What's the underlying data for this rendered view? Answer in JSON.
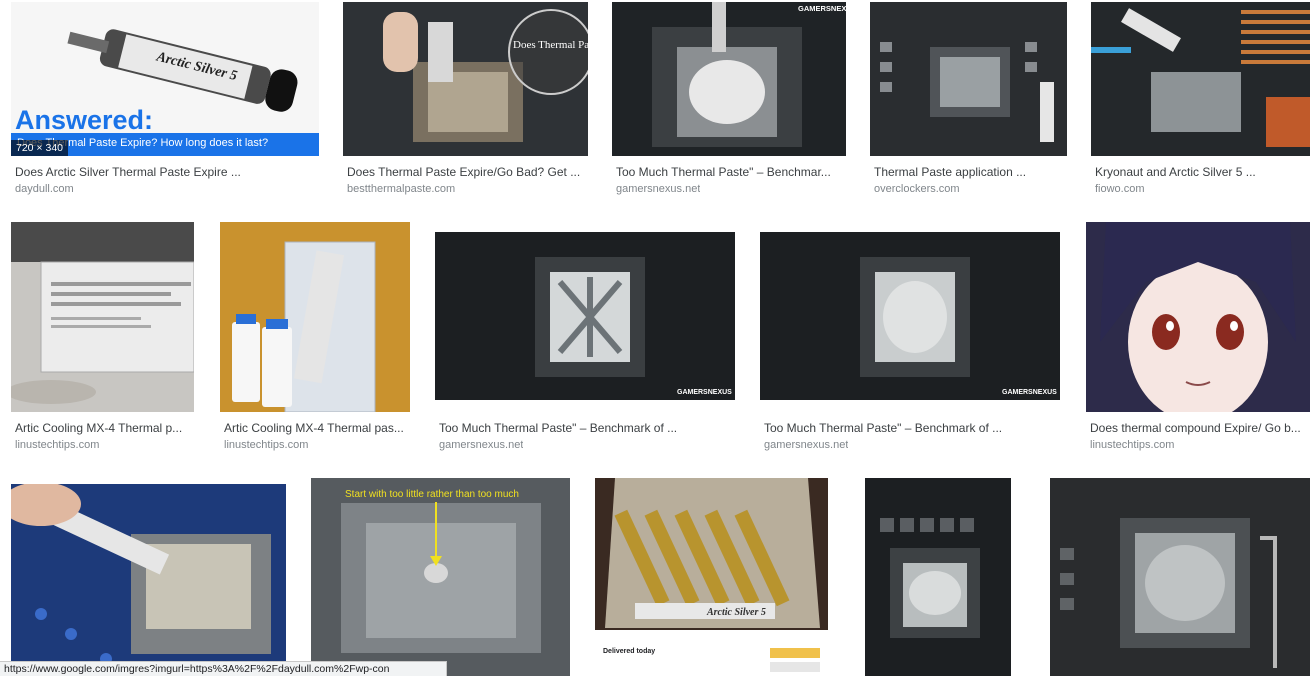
{
  "results": [
    {
      "caption": "Does Arctic Silver Thermal Paste Expire ...",
      "domain": "daydull.com",
      "dims": "720 × 340",
      "overlay_title": "Answered:",
      "overlay_sub": "Does Thermal Paste Expire? How long does it last?",
      "product_label": "Arctic Silver 5"
    },
    {
      "caption": "Does Thermal Paste Expire/Go Bad? Get ...",
      "domain": "bestthermalpaste.com",
      "overlay_text": "Does Thermal Paste Expire"
    },
    {
      "caption": "Too Much Thermal Paste\" – Benchmar...",
      "domain": "gamersnexus.net",
      "watermark": "GAMERSNEX"
    },
    {
      "caption": "Thermal Paste application ...",
      "domain": "overclockers.com"
    },
    {
      "caption": "Kryonaut and Arctic Silver 5 ...",
      "domain": "fiowo.com"
    },
    {
      "caption": "Artic Cooling MX-4 Thermal p...",
      "domain": "linustechtips.com"
    },
    {
      "caption": "Artic Cooling MX-4 Thermal pas...",
      "domain": "linustechtips.com"
    },
    {
      "caption": "Too Much Thermal Paste\" – Benchmark of ...",
      "domain": "gamersnexus.net",
      "watermark": "GAMERSNEXUS"
    },
    {
      "caption": "Too Much Thermal Paste\" – Benchmark of ...",
      "domain": "gamersnexus.net",
      "watermark": "GAMERSNEXUS"
    },
    {
      "caption": "Does thermal compound Expire/ Go b...",
      "domain": "linustechtips.com"
    },
    {
      "caption": "",
      "domain": ""
    },
    {
      "caption": "",
      "domain": "",
      "overlay_text": "Start with too little rather than too much"
    },
    {
      "caption": "",
      "domain": "",
      "product_label": "Arctic Silver 5",
      "receipt_text": "Delivered today"
    },
    {
      "caption": "",
      "domain": ""
    },
    {
      "caption": "",
      "domain": ""
    }
  ],
  "status_url": "https://www.google.com/imgres?imgurl=https%3A%2F%2Fdaydull.com%2Fwp-con",
  "colors": {
    "caption": "#3c4043",
    "domain": "#80868b",
    "answered_blue": "#1a73e8"
  }
}
